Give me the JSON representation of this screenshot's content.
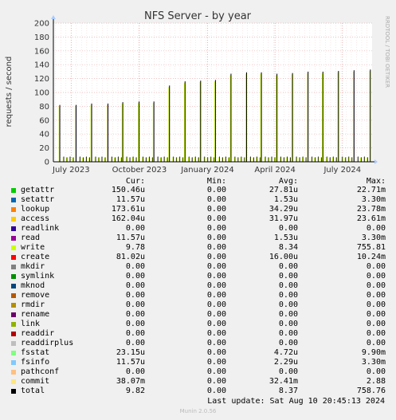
{
  "vertical_label": "RRDTOOL / TOBI OETIKER",
  "footer": {
    "last_update": "Last update: Sat Aug 10 20:45:13 2024",
    "munin_version": "Munin 2.0.56"
  },
  "legend": {
    "headers": {
      "cur": "Cur:",
      "min": "Min:",
      "avg": "Avg:",
      "max": "Max:"
    },
    "rows": [
      {
        "name": "getattr",
        "color": "#00cc00",
        "cur": "150.46u",
        "min": "0.00",
        "avg": "27.81u",
        "max": "22.71m"
      },
      {
        "name": "setattr",
        "color": "#0066b3",
        "cur": "11.57u",
        "min": "0.00",
        "avg": "1.53u",
        "max": "3.30m"
      },
      {
        "name": "lookup",
        "color": "#ff8000",
        "cur": "173.61u",
        "min": "0.00",
        "avg": "34.29u",
        "max": "23.78m"
      },
      {
        "name": "access",
        "color": "#ffcc00",
        "cur": "162.04u",
        "min": "0.00",
        "avg": "31.97u",
        "max": "23.61m"
      },
      {
        "name": "readlink",
        "color": "#330099",
        "cur": "0.00",
        "min": "0.00",
        "avg": "0.00",
        "max": "0.00"
      },
      {
        "name": "read",
        "color": "#990099",
        "cur": "11.57u",
        "min": "0.00",
        "avg": "1.53u",
        "max": "3.30m"
      },
      {
        "name": "write",
        "color": "#ccff00",
        "cur": "9.78",
        "min": "0.00",
        "avg": "8.34",
        "max": "755.81"
      },
      {
        "name": "create",
        "color": "#ff0000",
        "cur": "81.02u",
        "min": "0.00",
        "avg": "16.00u",
        "max": "10.24m"
      },
      {
        "name": "mkdir",
        "color": "#808080",
        "cur": "0.00",
        "min": "0.00",
        "avg": "0.00",
        "max": "0.00"
      },
      {
        "name": "symlink",
        "color": "#008f00",
        "cur": "0.00",
        "min": "0.00",
        "avg": "0.00",
        "max": "0.00"
      },
      {
        "name": "mknod",
        "color": "#00487d",
        "cur": "0.00",
        "min": "0.00",
        "avg": "0.00",
        "max": "0.00"
      },
      {
        "name": "remove",
        "color": "#b35a00",
        "cur": "0.00",
        "min": "0.00",
        "avg": "0.00",
        "max": "0.00"
      },
      {
        "name": "rmdir",
        "color": "#b38f00",
        "cur": "0.00",
        "min": "0.00",
        "avg": "0.00",
        "max": "0.00"
      },
      {
        "name": "rename",
        "color": "#6b006b",
        "cur": "0.00",
        "min": "0.00",
        "avg": "0.00",
        "max": "0.00"
      },
      {
        "name": "link",
        "color": "#8fb300",
        "cur": "0.00",
        "min": "0.00",
        "avg": "0.00",
        "max": "0.00"
      },
      {
        "name": "readdir",
        "color": "#b30000",
        "cur": "0.00",
        "min": "0.00",
        "avg": "0.00",
        "max": "0.00"
      },
      {
        "name": "readdirplus",
        "color": "#bebebe",
        "cur": "0.00",
        "min": "0.00",
        "avg": "0.00",
        "max": "0.00"
      },
      {
        "name": "fsstat",
        "color": "#80ff80",
        "cur": "23.15u",
        "min": "0.00",
        "avg": "4.72u",
        "max": "9.90m"
      },
      {
        "name": "fsinfo",
        "color": "#80c9ff",
        "cur": "11.57u",
        "min": "0.00",
        "avg": "2.29u",
        "max": "3.30m"
      },
      {
        "name": "pathconf",
        "color": "#ffc080",
        "cur": "0.00",
        "min": "0.00",
        "avg": "0.00",
        "max": "0.00"
      },
      {
        "name": "commit",
        "color": "#ffe680",
        "cur": "38.07m",
        "min": "0.00",
        "avg": "32.41m",
        "max": "2.88"
      },
      {
        "name": "total",
        "color": "#000000",
        "cur": "9.82",
        "min": "0.00",
        "avg": "8.37",
        "max": "758.76"
      }
    ]
  },
  "chart_data": {
    "type": "line",
    "title": "NFS Server - by year",
    "ylabel": "requests / second",
    "xlabel": "",
    "ylim": [
      0,
      200
    ],
    "yticks": [
      0,
      20,
      40,
      60,
      80,
      100,
      120,
      140,
      160,
      180,
      200
    ],
    "xticks": [
      {
        "label": "July 2023",
        "date": "2023-07-01"
      },
      {
        "label": "October 2023",
        "date": "2023-10-01"
      },
      {
        "label": "January 2024",
        "date": "2024-01-01"
      },
      {
        "label": "April 2024",
        "date": "2024-04-01"
      },
      {
        "label": "July 2024",
        "date": "2024-07-01"
      }
    ],
    "xlim": [
      "2023-06-07",
      "2024-08-10"
    ],
    "grid": true,
    "series": [
      {
        "name": "total",
        "color": "#000000",
        "spikes": [
          {
            "date": "2023-06-15",
            "value": 82
          },
          {
            "date": "2023-07-07",
            "value": 82
          },
          {
            "date": "2023-07-28",
            "value": 84
          },
          {
            "date": "2023-08-19",
            "value": 84
          },
          {
            "date": "2023-09-08",
            "value": 86
          },
          {
            "date": "2023-09-30",
            "value": 87
          },
          {
            "date": "2023-10-20",
            "value": 87
          },
          {
            "date": "2023-11-10",
            "value": 110
          },
          {
            "date": "2023-12-01",
            "value": 116
          },
          {
            "date": "2023-12-22",
            "value": 117
          },
          {
            "date": "2024-01-11",
            "value": 118
          },
          {
            "date": "2024-02-01",
            "value": 127
          },
          {
            "date": "2024-02-22",
            "value": 129
          },
          {
            "date": "2024-03-13",
            "value": 129
          },
          {
            "date": "2024-04-03",
            "value": 127
          },
          {
            "date": "2024-04-24",
            "value": 128
          },
          {
            "date": "2024-05-15",
            "value": 130
          },
          {
            "date": "2024-06-04",
            "value": 130
          },
          {
            "date": "2024-06-25",
            "value": 131
          },
          {
            "date": "2024-07-16",
            "value": 132
          },
          {
            "date": "2024-08-07",
            "value": 133
          }
        ],
        "small_peak": 7,
        "current": 9.82
      }
    ]
  }
}
